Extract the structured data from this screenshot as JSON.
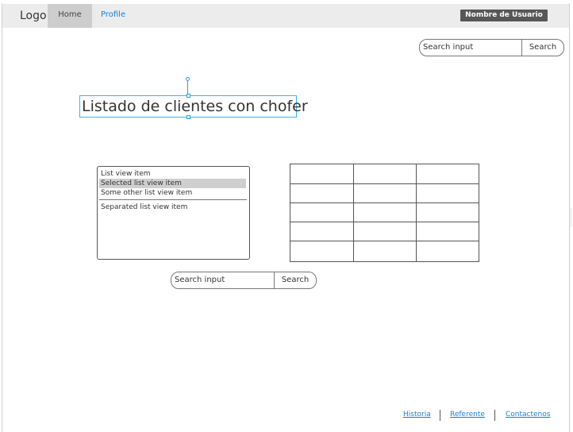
{
  "navbar": {
    "logo": "Logo",
    "home": "Home",
    "profile": "Profile",
    "user_button": "Nombre de Usuario"
  },
  "search_top": {
    "placeholder": "Search input",
    "button": "Search"
  },
  "title": "Listado de clientes con chofer",
  "listview": {
    "items": [
      "List view item",
      "Selected list view item",
      "Some other list view item",
      "Separated list view item"
    ],
    "selected_index": 1
  },
  "table": {
    "rows": 5,
    "columns": 3
  },
  "search_bottom": {
    "placeholder": "Search input",
    "button": "Search"
  },
  "footer": {
    "links": [
      "Historia",
      "Referente",
      "Contactenos"
    ]
  },
  "colors": {
    "accent_link": "#1a7fd4",
    "selection": "#3bb6e8",
    "user_button_bg": "#575757"
  }
}
